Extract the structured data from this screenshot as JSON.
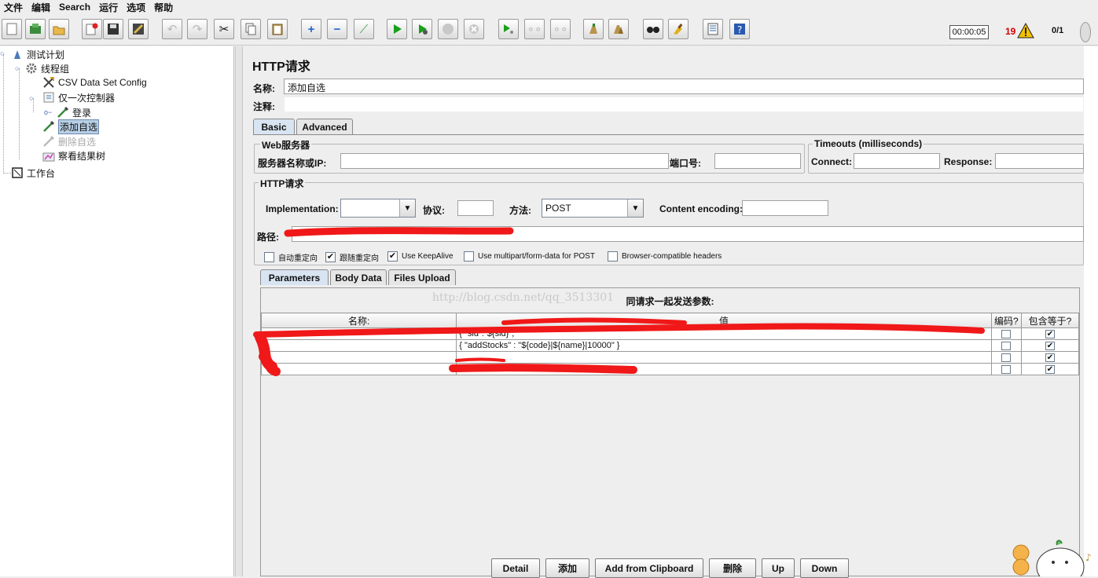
{
  "menu": [
    "文件",
    "编辑",
    "Search",
    "运行",
    "选项",
    "帮助"
  ],
  "toolbar": {
    "timer": "00:00:05",
    "error_count": "19",
    "threads": "0/1"
  },
  "tree": {
    "items": [
      {
        "label": "测试计划"
      },
      {
        "label": "线程组"
      },
      {
        "label": "CSV Data Set Config"
      },
      {
        "label": "仅一次控制器"
      },
      {
        "label": "登录"
      },
      {
        "label": "添加自选"
      },
      {
        "label": "删除自选"
      },
      {
        "label": "察看结果树"
      },
      {
        "label": "工作台"
      }
    ]
  },
  "panel": {
    "title": "HTTP请求",
    "name_label": "名称:",
    "name_value": "添加自选",
    "comment_label": "注释:",
    "tabs": [
      "Basic",
      "Advanced"
    ],
    "web_server": {
      "group_title": "Web服务器",
      "server_label": "服务器名称或IP:",
      "port_label": "端口号:"
    },
    "timeouts": {
      "group_title": "Timeouts (milliseconds)",
      "connect_label": "Connect:",
      "response_label": "Response:"
    },
    "http_request": {
      "group_title": "HTTP请求",
      "implementation_label": "Implementation:",
      "implementation_value": "",
      "protocol_label": "协议:",
      "method_label": "方法:",
      "method_value": "POST",
      "encoding_label": "Content encoding:",
      "path_label": "路径:"
    },
    "options": [
      {
        "label": "自动重定向",
        "checked": false
      },
      {
        "label": "跟随重定向",
        "checked": true
      },
      {
        "label": "Use KeepAlive",
        "checked": true
      },
      {
        "label": "Use multipart/form-data for POST",
        "checked": false
      },
      {
        "label": "Browser-compatible headers",
        "checked": false
      }
    ],
    "sub_tabs": [
      "Parameters",
      "Body Data",
      "Files Upload"
    ],
    "params": {
      "caption": "同请求一起发送参数:",
      "watermark": "http://blog.csdn.net/qq_3513301",
      "headers": [
        "名称:",
        "值",
        "编码?",
        "包含等于?"
      ],
      "rows": [
        {
          "name": "",
          "value": "{ \"sid\":\"${sid}\",",
          "encode": false,
          "include_equals": true
        },
        {
          "name": "",
          "value": "{  \"addStocks\" : \"${code}|${name}|10000\" }",
          "encode": false,
          "include_equals": true
        },
        {
          "name": "",
          "value": "",
          "encode": false,
          "include_equals": true
        },
        {
          "name": "",
          "value": "",
          "encode": false,
          "include_equals": true
        }
      ]
    },
    "buttons": [
      "Detail",
      "添加",
      "Add from Clipboard",
      "删除",
      "Up",
      "Down"
    ]
  }
}
